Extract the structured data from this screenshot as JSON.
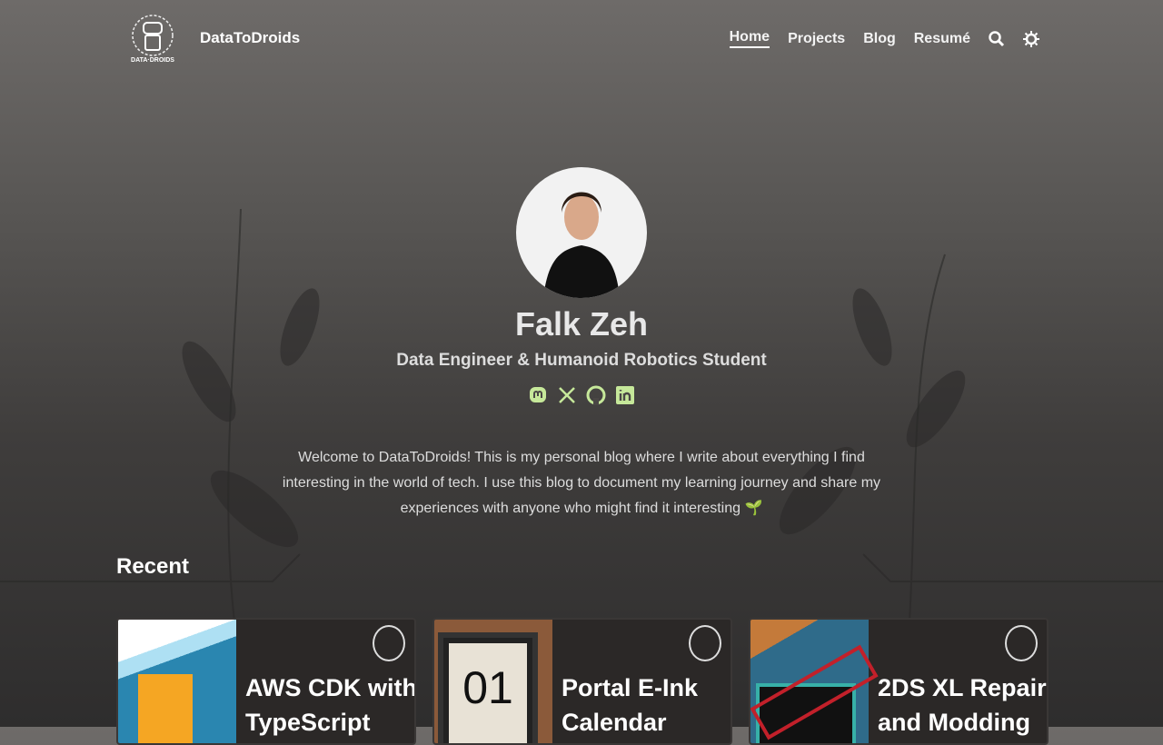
{
  "header": {
    "brand": "DataToDroids",
    "nav": [
      "Home",
      "Projects",
      "Blog",
      "Resumé"
    ]
  },
  "profile": {
    "name": "Falk Zeh",
    "subtitle": "Data Engineer & Humanoid Robotics Student",
    "intro": "Welcome to DataToDroids! This is my personal blog where I write about everything I find interesting in the world of tech. I use this blog to document my learning journey and share my experiences with anyone who might find it interesting 🌱"
  },
  "recent": {
    "heading": "Recent",
    "cards": [
      {
        "title": "AWS  CDK  with",
        "title2": "TypeScript"
      },
      {
        "title": "Portal E-Ink",
        "title2": "Calendar"
      },
      {
        "title": "2DS XL Repair",
        "title2": "and Modding"
      }
    ]
  }
}
